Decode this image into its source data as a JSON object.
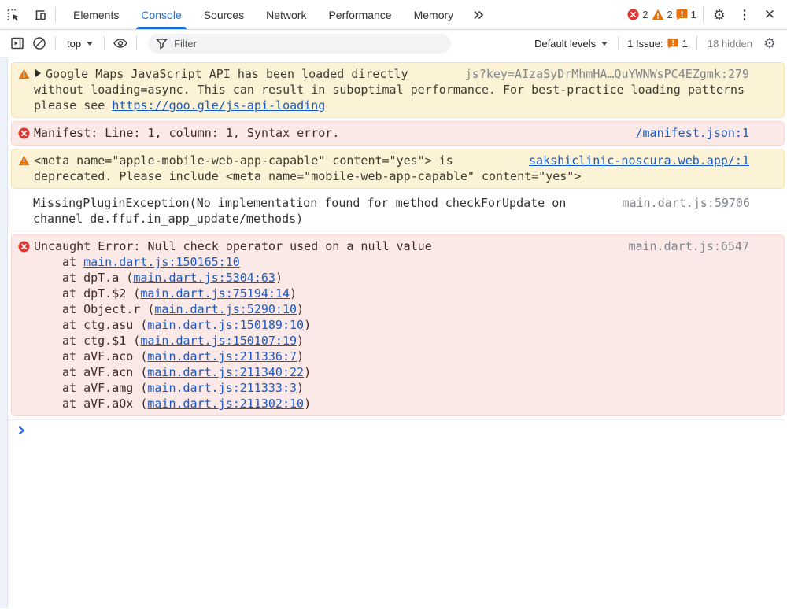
{
  "tabbar": {
    "tabs": [
      {
        "label": "Elements",
        "active": false
      },
      {
        "label": "Console",
        "active": true
      },
      {
        "label": "Sources",
        "active": false
      },
      {
        "label": "Network",
        "active": false
      },
      {
        "label": "Performance",
        "active": false
      },
      {
        "label": "Memory",
        "active": false
      }
    ],
    "error_count": "2",
    "warning_count": "2",
    "issue_count": "1"
  },
  "console_toolbar": {
    "context_selector": "top",
    "filter_placeholder": "Filter",
    "levels_selector": "Default levels",
    "issues_label": "1 Issue:",
    "issues_count": "1",
    "hidden_label": "18 hidden"
  },
  "messages": {
    "maps_warning": {
      "text_before_link": "Google Maps JavaScript API has been loaded directly without loading=async. This can result in suboptimal performance. For best-practice loading patterns please see ",
      "link": "https://goo.gle/js-api-loading",
      "source": "js?key=AIzaSyDrMhmHA…QuYWNWsPC4EZgmk:279"
    },
    "manifest_error": {
      "text": "Manifest: Line: 1, column: 1, Syntax error.",
      "source": "/manifest.json:1"
    },
    "meta_warning": {
      "text": "<meta name=\"apple-mobile-web-app-capable\" content=\"yes\"> is deprecated. Please include <meta name=\"mobile-web-app-capable\" content=\"yes\">",
      "source": "sakshiclinic-noscura.web.app/:1"
    },
    "plugin_info": {
      "text": "MissingPluginException(No implementation found for method checkForUpdate on channel de.ffuf.in_app_update/methods)",
      "source": "main.dart.js:59706"
    },
    "uncaught_error": {
      "text": "Uncaught Error: Null check operator used on a null value",
      "source": "main.dart.js:6547",
      "stack": [
        {
          "pre": "at ",
          "link": "main.dart.js:150165:10",
          "post": ""
        },
        {
          "pre": "at dpT.a (",
          "link": "main.dart.js:5304:63",
          "post": ")"
        },
        {
          "pre": "at dpT.$2 (",
          "link": "main.dart.js:75194:14",
          "post": ")"
        },
        {
          "pre": "at Object.r (",
          "link": "main.dart.js:5290:10",
          "post": ")"
        },
        {
          "pre": "at ctg.asu (",
          "link": "main.dart.js:150189:10",
          "post": ")"
        },
        {
          "pre": "at ctg.$1 (",
          "link": "main.dart.js:150107:19",
          "post": ")"
        },
        {
          "pre": "at aVF.aco (",
          "link": "main.dart.js:211336:7",
          "post": ")"
        },
        {
          "pre": "at aVF.acn (",
          "link": "main.dart.js:211340:22",
          "post": ")"
        },
        {
          "pre": "at aVF.amg (",
          "link": "main.dart.js:211333:3",
          "post": ")"
        },
        {
          "pre": "at aVF.aOx (",
          "link": "main.dart.js:211302:10",
          "post": ")"
        }
      ]
    }
  },
  "colors": {
    "accent_blue": "#1a73e8",
    "link_blue": "#1a58c2",
    "error_red": "#de3730",
    "warning_orange": "#e8710a",
    "warning_bg": "#fcf2d6",
    "error_bg": "#fbe9e7",
    "source_gray": "#80868b"
  }
}
